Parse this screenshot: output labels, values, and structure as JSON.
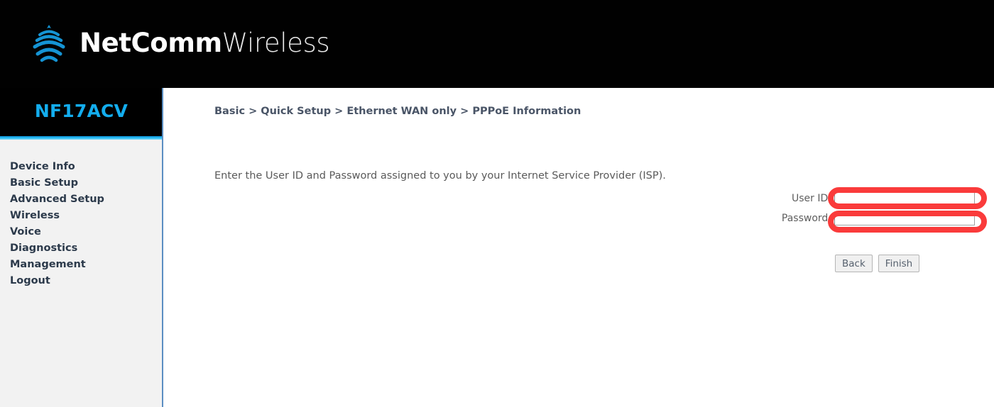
{
  "brand": {
    "name_bold": "NetComm",
    "name_light": "Wireless",
    "logo_icon": "wifi-signal-icon",
    "logo_color": "#1594d4"
  },
  "sidebar": {
    "model": "NF17ACV",
    "model_color": "#13adee",
    "accent_color": "#2fc0f5",
    "items": [
      {
        "label": "Device Info",
        "name": "device-info"
      },
      {
        "label": "Basic Setup",
        "name": "basic-setup"
      },
      {
        "label": "Advanced Setup",
        "name": "advanced-setup"
      },
      {
        "label": "Wireless",
        "name": "wireless"
      },
      {
        "label": "Voice",
        "name": "voice"
      },
      {
        "label": "Diagnostics",
        "name": "diagnostics"
      },
      {
        "label": "Management",
        "name": "management"
      },
      {
        "label": "Logout",
        "name": "logout"
      }
    ]
  },
  "main": {
    "breadcrumb": "Basic > Quick Setup > Ethernet WAN only > PPPoE Information",
    "instruction": "Enter the User ID and Password assigned to you by your Internet Service Provider (ISP).",
    "form": {
      "user_id": {
        "label": "User ID:",
        "value": "",
        "placeholder": ""
      },
      "password": {
        "label": "Password:",
        "value": "",
        "placeholder": ""
      }
    },
    "buttons": {
      "back": "Back",
      "finish": "Finish"
    }
  },
  "annotations": {
    "color": "#fa3b3b",
    "shapes": [
      {
        "name": "user-id-highlight",
        "target": "User ID"
      },
      {
        "name": "password-highlight",
        "target": "Password"
      }
    ]
  }
}
